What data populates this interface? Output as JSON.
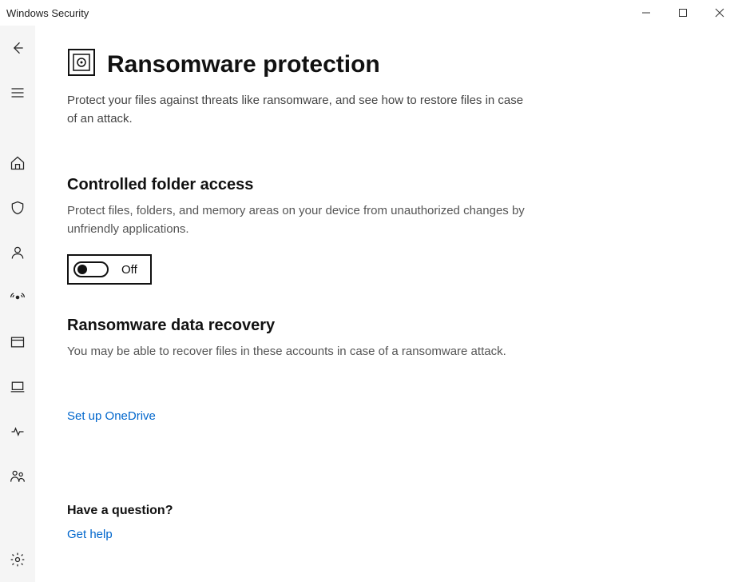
{
  "window": {
    "title": "Windows Security"
  },
  "sidebar": {
    "items": [
      {
        "name": "back"
      },
      {
        "name": "menu"
      },
      {
        "name": "home"
      },
      {
        "name": "virus"
      },
      {
        "name": "account"
      },
      {
        "name": "firewall"
      },
      {
        "name": "app-browser"
      },
      {
        "name": "device-security"
      },
      {
        "name": "device-performance"
      },
      {
        "name": "family"
      }
    ]
  },
  "page": {
    "title": "Ransomware protection",
    "subtitle": "Protect your files against threats like ransomware, and see how to restore files in case of an attack."
  },
  "controlled_folder": {
    "heading": "Controlled folder access",
    "description": "Protect files, folders, and memory areas on your device from unauthorized changes by unfriendly applications.",
    "toggle_state": "Off"
  },
  "data_recovery": {
    "heading": "Ransomware data recovery",
    "description": "You may be able to recover files in these accounts in case of a ransomware attack.",
    "link": "Set up OneDrive"
  },
  "help": {
    "heading": "Have a question?",
    "link": "Get help"
  }
}
